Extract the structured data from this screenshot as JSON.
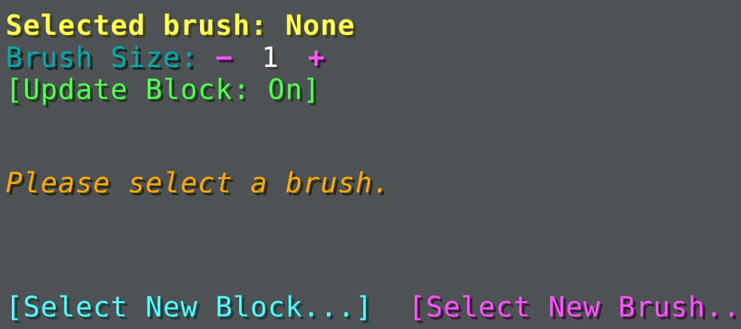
{
  "header": {
    "title": "Selected brush: None"
  },
  "brush_size": {
    "label": "Brush Size:",
    "decrement": "−",
    "value": "1",
    "increment": "+"
  },
  "update_block": {
    "text": "[Update Block: On]"
  },
  "message": {
    "text": "Please select a brush."
  },
  "actions": {
    "select_block": "[Select New Block...]",
    "select_brush": "[Select New Brush...]"
  },
  "colors": {
    "background": "#4f5254",
    "title": "#ffff55",
    "size_label": "#00aaaa",
    "accent_magenta": "#ff55ff",
    "toggle_green": "#55ff55",
    "message_orange": "#ffaa00",
    "select_block_cyan": "#55ffff"
  }
}
